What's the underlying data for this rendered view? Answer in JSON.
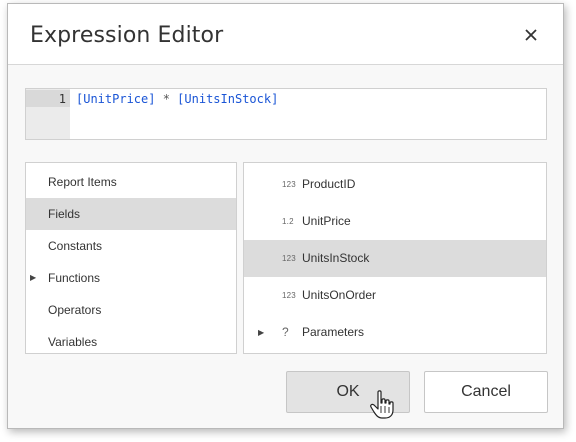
{
  "dialog": {
    "title": "Expression Editor",
    "close_icon": "close-icon"
  },
  "editor": {
    "line_number": "1",
    "tokens": {
      "field1": "[UnitPrice]",
      "operator": " * ",
      "field2": "[UnitsInStock]"
    }
  },
  "categories": {
    "items": [
      {
        "label": "Report Items"
      },
      {
        "label": "Fields",
        "selected": true
      },
      {
        "label": "Constants"
      },
      {
        "label": "Functions",
        "expandable": true
      },
      {
        "label": "Operators"
      },
      {
        "label": "Variables"
      }
    ]
  },
  "fields": {
    "items": [
      {
        "type": "123",
        "label": "ProductID"
      },
      {
        "type": "1.2",
        "label": "UnitPrice"
      },
      {
        "type": "123",
        "label": "UnitsInStock",
        "selected": true
      },
      {
        "type": "123",
        "label": "UnitsOnOrder"
      },
      {
        "type": "?",
        "label": "Parameters",
        "expandable": true
      }
    ]
  },
  "buttons": {
    "ok_label": "OK",
    "cancel_label": "Cancel"
  },
  "colors": {
    "field_token": "#1a55d6",
    "selected_row": "#dcdcdc",
    "ok_button": "#e3e3e3"
  }
}
